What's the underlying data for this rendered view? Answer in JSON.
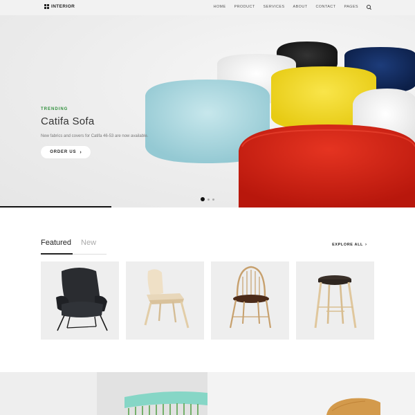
{
  "header": {
    "logo_text": "INTERIOR",
    "nav": [
      {
        "label": "HOME"
      },
      {
        "label": "PRODUCT"
      },
      {
        "label": "SERVICES"
      },
      {
        "label": "ABOUT"
      },
      {
        "label": "CONTACT"
      },
      {
        "label": "PAGES"
      }
    ],
    "search_icon": "search-icon"
  },
  "hero": {
    "eyebrow": "TRENDING",
    "title": "Catifa Sofa",
    "description": "New fabrics and covers for Catifa 46-53 are now available.",
    "cta_label": "ORDER US",
    "slides_total": 3,
    "slide_active": 1,
    "pouf_colors": [
      "#a9d8e0",
      "#f4f4f4",
      "#1a1a1a",
      "#f0dc2c",
      "#12285a",
      "#ececec",
      "#d71f12"
    ],
    "accent_color": "#2f8f3c"
  },
  "products": {
    "tabs": [
      {
        "label": "Featured",
        "active": true
      },
      {
        "label": "New",
        "active": false
      }
    ],
    "explore_label": "EXPLORE ALL",
    "items": [
      {
        "icon": "black-lounge-chair-image"
      },
      {
        "icon": "wooden-cafe-chair-image"
      },
      {
        "icon": "windsor-chair-image"
      },
      {
        "icon": "wooden-stool-image"
      }
    ]
  },
  "banners": [
    {
      "icon": "mint-chair-image"
    },
    {
      "icon": "wood-chair-image"
    }
  ]
}
